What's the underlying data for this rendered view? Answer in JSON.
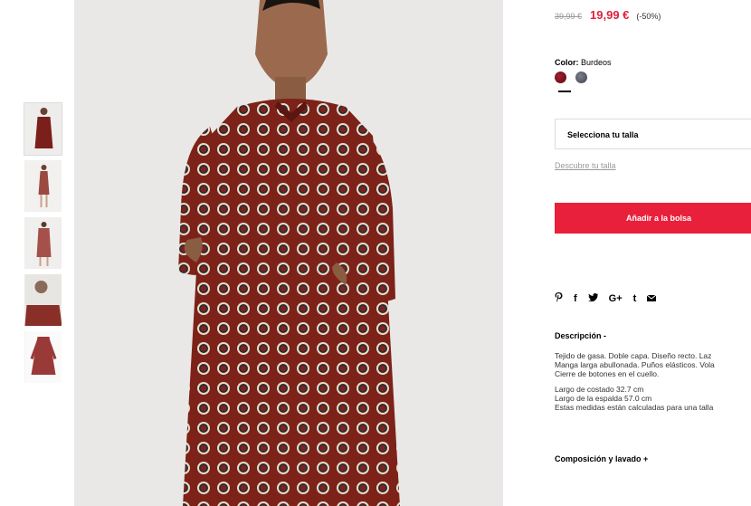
{
  "thumbnails": [
    {
      "alt": "thumb-front"
    },
    {
      "alt": "thumb-full"
    },
    {
      "alt": "thumb-back"
    },
    {
      "alt": "thumb-detail"
    },
    {
      "alt": "thumb-flat"
    }
  ],
  "product": {
    "old_price": "39,99 €",
    "new_price": "19,99 €",
    "discount": "(-50%)",
    "color_label": "Color:",
    "color_value": "Burdeos",
    "colors": [
      "#7a1420",
      "#565b68"
    ],
    "size_select": "Selecciona tu talla",
    "size_link": "Descubre tu talla",
    "add_button": "Añadir a la bolsa",
    "accent_color": "#e9203b"
  },
  "social": {
    "pinterest": "P",
    "facebook": "f",
    "twitter": "t",
    "googleplus": "G+",
    "tumblr": "t",
    "email": "✉"
  },
  "description": {
    "title": "Descripción -",
    "line1": "Tejido de gasa. Doble capa. Diseño recto. Laz",
    "line2": "Manga larga abullonada. Puños elásticos. Vola",
    "line3": "Cierre de botones en el cuello.",
    "line4": "Largo de costado 32.7 cm",
    "line5": "Largo de la espalda 57.0 cm",
    "line6": "Estas medidas están calculadas para una talla"
  },
  "composition": {
    "title": "Composición y lavado +"
  }
}
